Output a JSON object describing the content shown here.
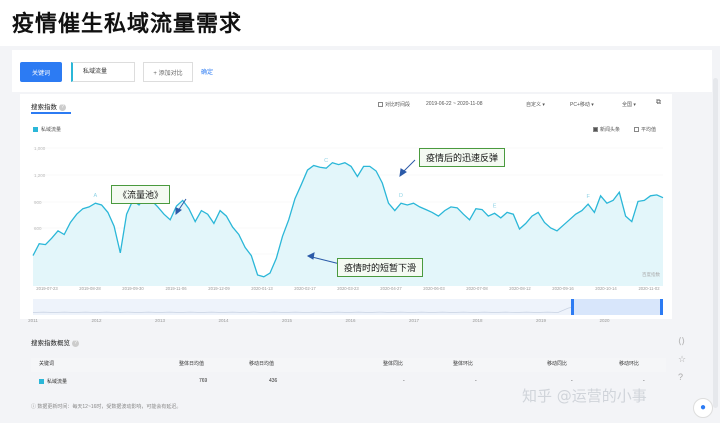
{
  "headline": "疫情催生私域流量需求",
  "toolbar": {
    "keyword_button": "关键词",
    "keyword_value": "私域流量",
    "add_compare": "+ 添加对比",
    "confirm": "确定"
  },
  "panel": {
    "tab_title": "搜索指数",
    "compare_period_label": "对比时间段",
    "date_range": "2019-06-22 ~ 2020-11-08",
    "custom_label": "自定义",
    "device_label": "PC+移动",
    "region_label": "全国",
    "legend_label": "私域流量",
    "news_label": "新闻头条",
    "avg_label": "平均值",
    "source_label": "百度指数"
  },
  "chart_data": {
    "type": "area",
    "title": "",
    "xlabel": "",
    "ylabel": "",
    "ylim": [
      0,
      1500
    ],
    "y_ticks": [
      "1,000",
      "1,200",
      "900",
      "600",
      "300"
    ],
    "x_ticks": [
      "2019-07-23",
      "2019-08-28",
      "2019-09-30",
      "2019-11-06",
      "2019-12-09",
      "2020-01-13",
      "2020-02-17",
      "2020-03-23",
      "2020-04-27",
      "2020-06-03",
      "2020-07-08",
      "2020-08-12",
      "2020-09-16",
      "2020-10-14",
      "2020-11-02"
    ],
    "series": [
      {
        "name": "私域流量",
        "color": "#2bb7d8",
        "values": [
          330,
          460,
          450,
          520,
          600,
          560,
          690,
          780,
          840,
          860,
          900,
          880,
          800,
          650,
          360,
          780,
          930,
          880,
          970,
          930,
          860,
          780,
          720,
          870,
          930,
          840,
          700,
          820,
          780,
          680,
          820,
          760,
          640,
          560,
          420,
          330,
          120,
          100,
          140,
          300,
          540,
          720,
          950,
          1100,
          1260,
          1310,
          1290,
          1280,
          1340,
          1320,
          1340,
          1300,
          1190,
          1300,
          1300,
          1250,
          1120,
          900,
          820,
          900,
          880,
          900,
          860,
          830,
          800,
          760,
          820,
          860,
          850,
          780,
          720,
          840,
          830,
          760,
          790,
          740,
          800,
          780,
          620,
          680,
          760,
          800,
          690,
          630,
          600,
          660,
          720,
          780,
          820,
          890,
          800,
          980,
          900,
          930,
          1020,
          760,
          700,
          920,
          930,
          980,
          990,
          960
        ]
      }
    ],
    "markers": [
      "A",
      "B",
      "C",
      "D",
      "E",
      "F"
    ]
  },
  "annotations": {
    "pool": "《流量池》",
    "rebound": "疫情后的迅速反弹",
    "drop": "疫情时的短暂下滑"
  },
  "overview_years": [
    "2011",
    "2012",
    "2013",
    "2014",
    "2015",
    "2016",
    "2017",
    "2018",
    "2019",
    "2020"
  ],
  "overview": {
    "title": "搜索指数概览",
    "columns": [
      "关键词",
      "整体日均值",
      "移动日均值",
      "整体同比",
      "整体环比",
      "移动同比",
      "移动环比"
    ],
    "rows": [
      {
        "keyword": "私域流量",
        "overall_avg": "769",
        "mobile_avg": "436",
        "overall_yoy": "-",
        "overall_mom": "-",
        "mobile_yoy": "-",
        "mobile_mom": "-"
      }
    ]
  },
  "note": "ⓘ 数据更新时间：每天12~16时，受数据波动影响，可能会有延迟。",
  "watermark": "知乎 @运营的小事"
}
